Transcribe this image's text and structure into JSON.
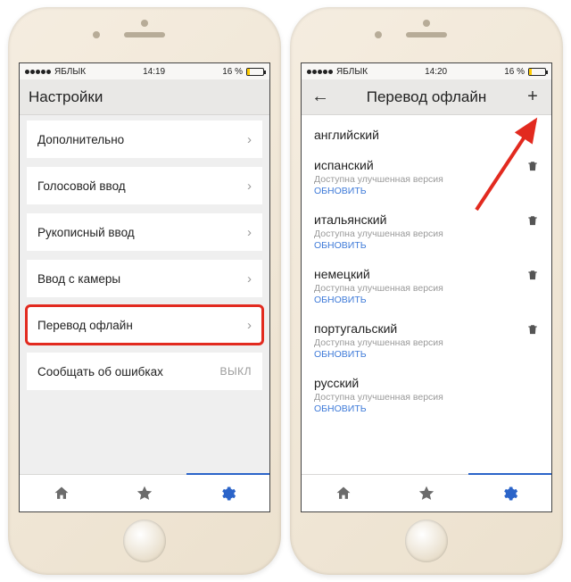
{
  "status": {
    "carrier": "ЯБЛЫК",
    "time_left": "14:19",
    "time_right": "14:20",
    "battery_pct": "16 %"
  },
  "left": {
    "header_title": "Настройки",
    "items": [
      {
        "label": "Дополнительно"
      },
      {
        "label": "Голосовой ввод"
      },
      {
        "label": "Рукописный ввод"
      },
      {
        "label": "Ввод с камеры"
      },
      {
        "label": "Перевод офлайн"
      },
      {
        "label": "Сообщать об ошибках",
        "value": "ВЫКЛ"
      }
    ]
  },
  "right": {
    "header_title": "Перевод офлайн",
    "languages": [
      {
        "name": "английский"
      },
      {
        "name": "испанский",
        "sub": "Доступна улучшенная версия",
        "update": "ОБНОВИТЬ"
      },
      {
        "name": "итальянский",
        "sub": "Доступна улучшенная версия",
        "update": "ОБНОВИТЬ"
      },
      {
        "name": "немецкий",
        "sub": "Доступна улучшенная версия",
        "update": "ОБНОВИТЬ"
      },
      {
        "name": "португальский",
        "sub": "Доступна улучшенная версия",
        "update": "ОБНОВИТЬ"
      },
      {
        "name": "русский",
        "sub": "Доступна улучшенная версия",
        "update": "ОБНОВИТЬ"
      }
    ]
  }
}
